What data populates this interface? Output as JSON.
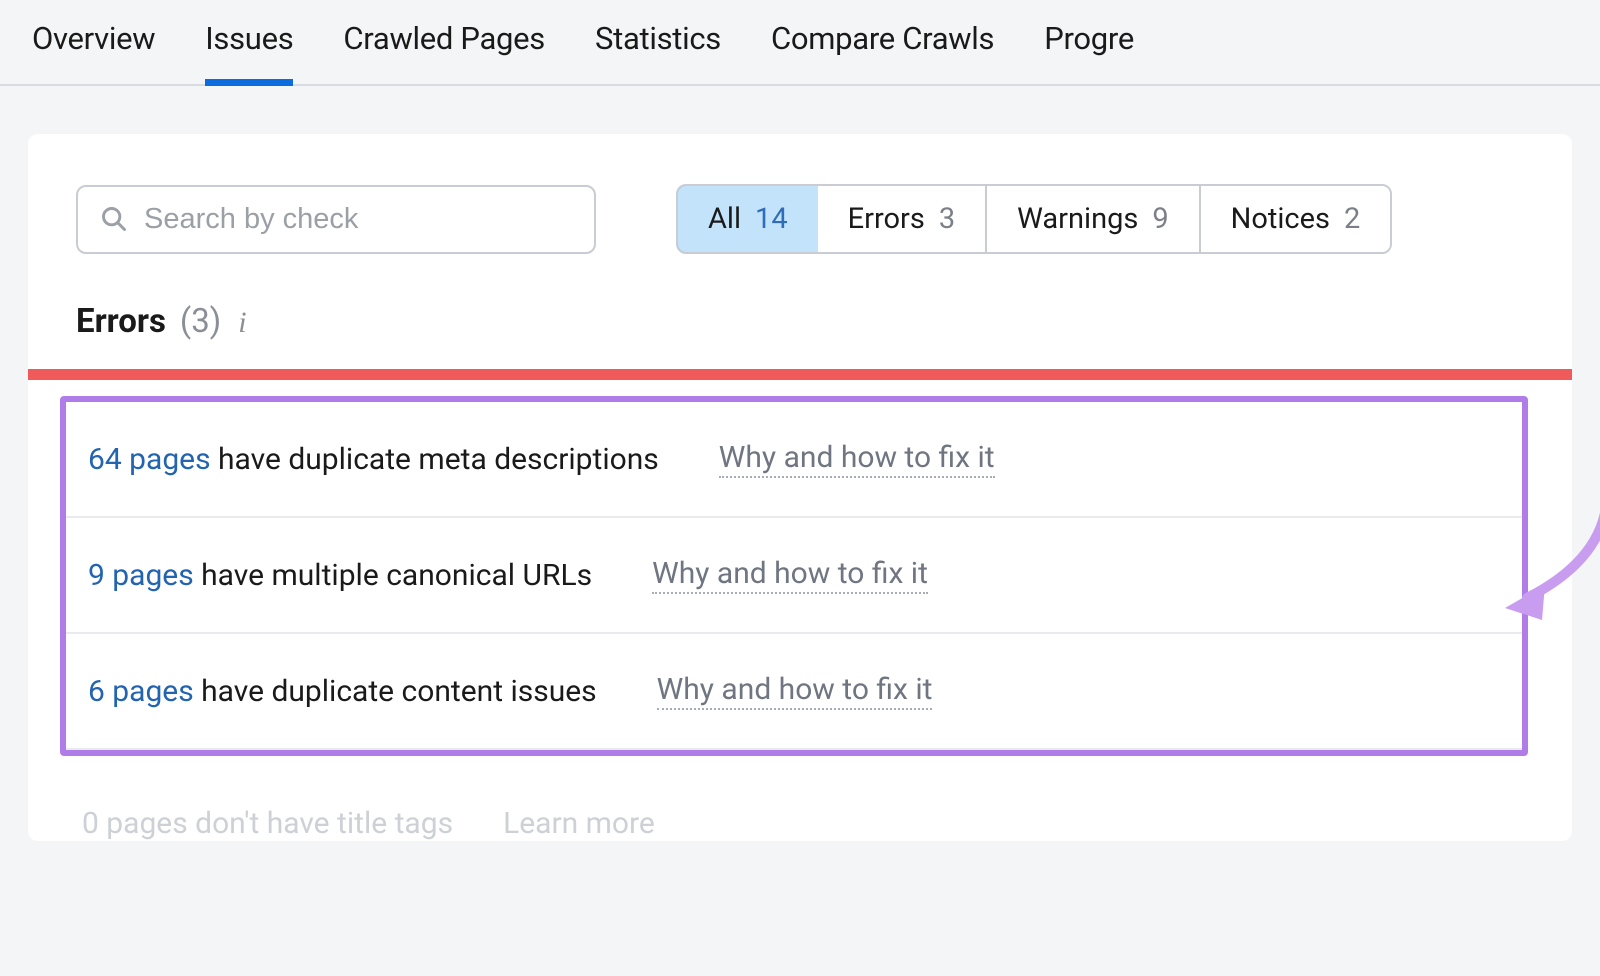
{
  "tabs": {
    "overview": "Overview",
    "issues": "Issues",
    "crawled": "Crawled Pages",
    "statistics": "Statistics",
    "compare": "Compare Crawls",
    "progress": "Progre"
  },
  "search": {
    "placeholder": "Search by check"
  },
  "filters": {
    "all": {
      "label": "All",
      "count": "14"
    },
    "errors": {
      "label": "Errors",
      "count": "3"
    },
    "warnings": {
      "label": "Warnings",
      "count": "9"
    },
    "notices": {
      "label": "Notices",
      "count": "2"
    }
  },
  "section": {
    "title": "Errors",
    "count": "(3)"
  },
  "issues": [
    {
      "link": "64 pages",
      "desc": " have duplicate meta descriptions",
      "fix": "Why and how to fix it"
    },
    {
      "link": "9 pages",
      "desc": " have multiple canonical URLs",
      "fix": "Why and how to fix it"
    },
    {
      "link": "6 pages",
      "desc": " have duplicate content issues",
      "fix": "Why and how to fix it"
    }
  ],
  "faded": {
    "desc": "0 pages don't have title tags",
    "learn": "Learn more"
  }
}
